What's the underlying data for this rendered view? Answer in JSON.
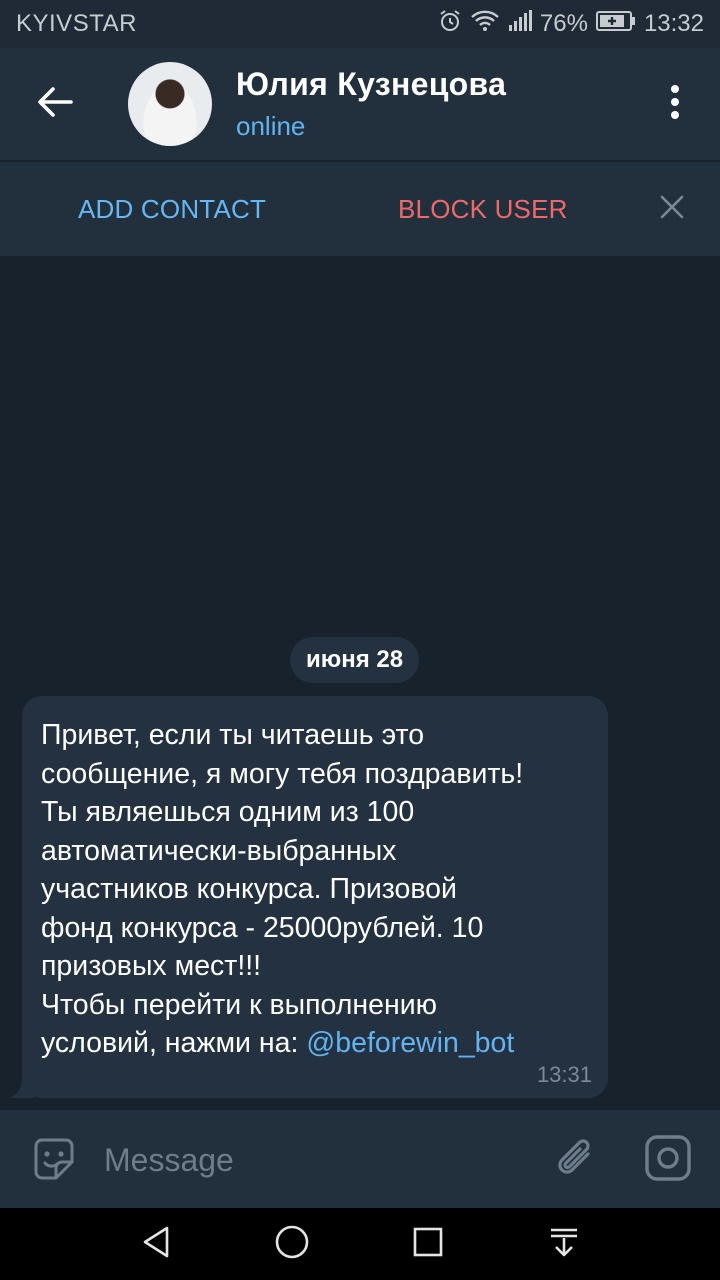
{
  "status_bar": {
    "carrier": "KYIVSTAR",
    "battery": "76%",
    "time": "13:32"
  },
  "header": {
    "title": "Юлия Кузнецова",
    "status": "online",
    "icons": [
      "back-arrow-icon",
      "avatar",
      "more-vert-icon"
    ]
  },
  "action_bar": {
    "add_contact": "ADD CONTACT",
    "block_user": "BLOCK USER",
    "close_icon": "close-icon"
  },
  "chat": {
    "date": "июня 28",
    "message": {
      "text": "Привет, если ты читаешь это\nсообщение, я могу тебя поздравить!\nТы являешься одним из 100\nавтоматически-выбранных\nучастников конкурса. Призовой\nфонд конкурса - 25000рублей. 10\nпризовых мест!!!\nЧтобы перейти к выполнению\nусловий, нажми на: ",
      "link": "@beforewin_bot",
      "time": "13:31"
    }
  },
  "input_bar": {
    "placeholder": "Message",
    "value": "",
    "icons": [
      "sticker-icon",
      "attach-icon",
      "camera-icon"
    ]
  },
  "nav_bar": {
    "icons": [
      "back-triangle-icon",
      "home-circle-icon",
      "recents-square-icon",
      "notifications-down-icon"
    ]
  },
  "colors": {
    "background": "#18222d",
    "header": "#222f3c",
    "bubble": "#243140",
    "accent_blue": "#62b3f0",
    "danger_red": "#ee6a6a"
  }
}
